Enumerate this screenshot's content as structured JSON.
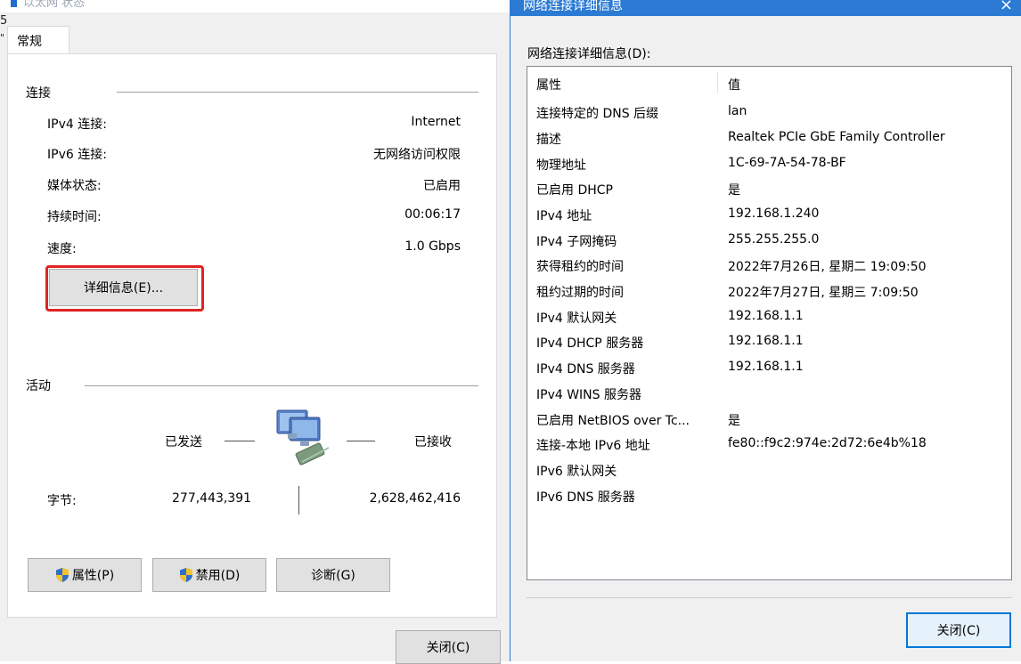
{
  "left": {
    "title": "以太网 状态",
    "clipped_chars": [
      "5",
      "\""
    ],
    "tab_general": "常规",
    "connection": {
      "title": "连接",
      "rows": [
        {
          "label": "IPv4 连接:",
          "value": "Internet"
        },
        {
          "label": "IPv6 连接:",
          "value": "无网络访问权限"
        },
        {
          "label": "媒体状态:",
          "value": "已启用"
        },
        {
          "label": "持续时间:",
          "value": "00:06:17"
        },
        {
          "label": "速度:",
          "value": "1.0 Gbps"
        }
      ],
      "details_button": "详细信息(E)..."
    },
    "activity": {
      "title": "活动",
      "sent_label": "已发送",
      "received_label": "已接收",
      "bytes_label": "字节:",
      "bytes_sent": "277,443,391",
      "bytes_received": "2,628,462,416"
    },
    "buttons": {
      "properties": "属性(P)",
      "disable": "禁用(D)",
      "diagnose": "诊断(G)",
      "close": "关闭(C)"
    }
  },
  "right": {
    "title": "网络连接详细信息",
    "list_heading": "网络连接详细信息(D):",
    "columns": {
      "property": "属性",
      "value": "值"
    },
    "rows": [
      {
        "name": "连接特定的 DNS 后缀",
        "value": "lan"
      },
      {
        "name": "描述",
        "value": "Realtek PCIe GbE Family Controller"
      },
      {
        "name": "物理地址",
        "value": "1C-69-7A-54-78-BF"
      },
      {
        "name": "已启用 DHCP",
        "value": "是"
      },
      {
        "name": "IPv4 地址",
        "value": "192.168.1.240"
      },
      {
        "name": "IPv4 子网掩码",
        "value": "255.255.255.0"
      },
      {
        "name": "获得租约的时间",
        "value": "2022年7月26日, 星期二 19:09:50"
      },
      {
        "name": "租约过期的时间",
        "value": "2022年7月27日, 星期三 7:09:50"
      },
      {
        "name": "IPv4 默认网关",
        "value": "192.168.1.1"
      },
      {
        "name": "IPv4 DHCP 服务器",
        "value": "192.168.1.1"
      },
      {
        "name": "IPv4 DNS 服务器",
        "value": "192.168.1.1"
      },
      {
        "name": "IPv4 WINS 服务器",
        "value": ""
      },
      {
        "name": "已启用 NetBIOS over Tc...",
        "value": "是"
      },
      {
        "name": "连接-本地 IPv6 地址",
        "value": "fe80::f9c2:974e:2d72:6e4b%18"
      },
      {
        "name": "IPv6 默认网关",
        "value": ""
      },
      {
        "name": "IPv6 DNS 服务器",
        "value": ""
      }
    ],
    "close_button": "关闭(C)",
    "close_icon": "×"
  },
  "colors": {
    "title_bar_blue": "#2b7bd4",
    "highlight_red": "#e02323",
    "dialog_bg": "#f0f0f0"
  }
}
